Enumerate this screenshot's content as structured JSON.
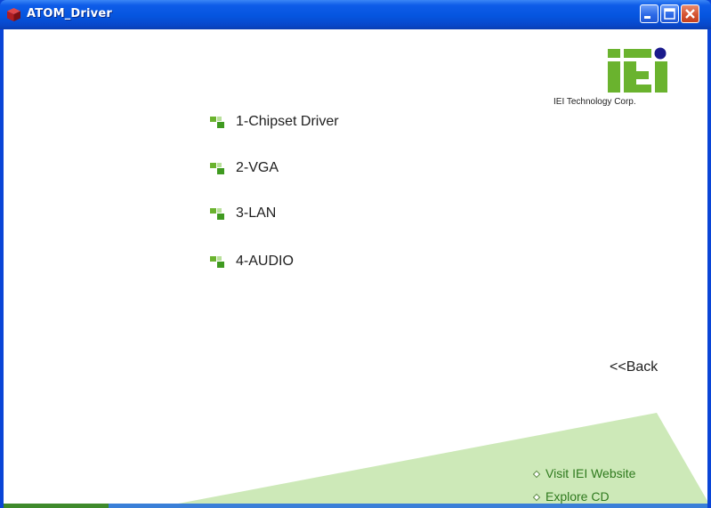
{
  "window": {
    "title": "ATOM_Driver",
    "controls": {
      "minimize": "minimize",
      "maximize": "maximize",
      "close": "close"
    }
  },
  "logo": {
    "mark": "iEi",
    "caption": "IEI Technology Corp."
  },
  "menu": {
    "items": [
      {
        "label": "1-Chipset Driver",
        "icon": "green-square-bullet-icon"
      },
      {
        "label": "2-VGA",
        "icon": "green-square-bullet-icon"
      },
      {
        "label": "3-LAN",
        "icon": "green-square-bullet-icon"
      },
      {
        "label": "4-AUDIO",
        "icon": "green-square-bullet-icon"
      }
    ]
  },
  "navigation": {
    "back_label": "<<Back"
  },
  "footer": {
    "links": [
      {
        "label": "Visit IEI Website",
        "icon": "diamond-bullet-icon"
      },
      {
        "label": "Explore CD",
        "icon": "diamond-bullet-icon"
      }
    ]
  },
  "colors": {
    "titlebar": "#0555df",
    "accent_green": "#6ab32e",
    "footer_band": "#cde9b8",
    "logo_dot": "#1a1a8c",
    "link_green": "#2f7a1e"
  }
}
